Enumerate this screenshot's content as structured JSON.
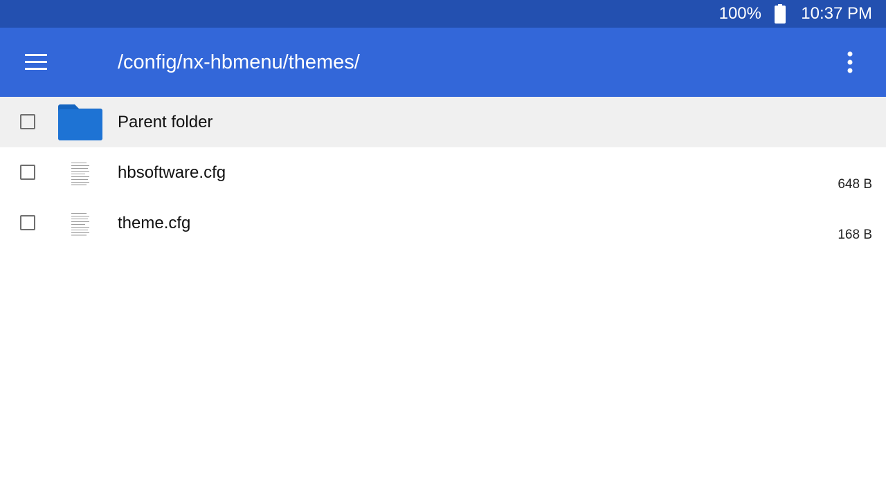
{
  "status_bar": {
    "battery_percent": "100%",
    "battery_icon": "battery-full-icon",
    "time": "10:37 PM"
  },
  "app_bar": {
    "menu_icon": "hamburger-menu-icon",
    "title": "/config/nx-hbmenu/themes/",
    "overflow_icon": "more-vert-icon"
  },
  "file_list": {
    "parent": {
      "label": "Parent folder",
      "icon": "folder-icon"
    },
    "items": [
      {
        "name": "hbsoftware.cfg",
        "size": "648 B",
        "icon": "document-icon"
      },
      {
        "name": "theme.cfg",
        "size": "168 B",
        "icon": "document-icon"
      }
    ]
  },
  "colors": {
    "status_bar": "#2350b0",
    "app_bar": "#3367d9",
    "parent_row": "#f0f0f0",
    "folder": "#1e73d4"
  }
}
